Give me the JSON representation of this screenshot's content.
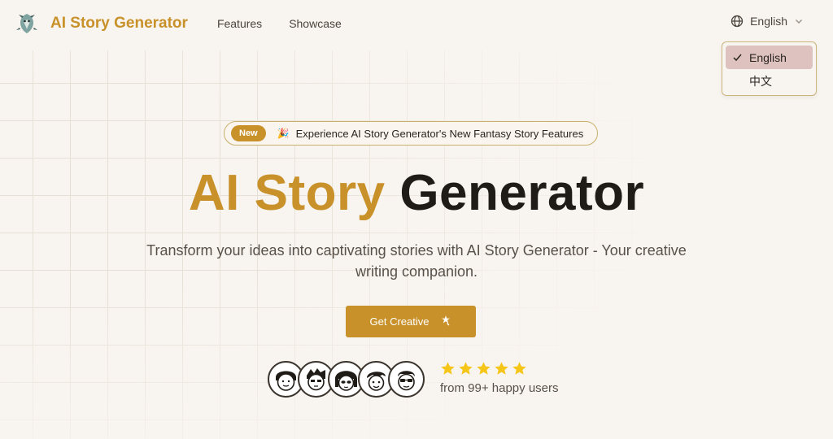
{
  "header": {
    "brand_title": "AI Story Generator",
    "logo_icon": "dragon-logo-icon",
    "nav": [
      {
        "label": "Features"
      },
      {
        "label": "Showcase"
      }
    ]
  },
  "language": {
    "current": "English",
    "options": [
      {
        "label": "English",
        "selected": true
      },
      {
        "label": "中文",
        "selected": false
      }
    ]
  },
  "announcement": {
    "badge": "New",
    "icon": "party-popper-icon",
    "text": "Experience AI Story Generator's New Fantasy Story Features"
  },
  "hero": {
    "title_accent": "AI Story",
    "title_dark": "Generator",
    "subtitle": "Transform your ideas into captivating stories with AI Story Generator - Your creative writing companion.",
    "cta_label": "Get Creative",
    "cta_icon": "magic-wand-icon"
  },
  "social_proof": {
    "avatar_count": 5,
    "rating_stars": 5,
    "text": "from 99+ happy users"
  },
  "colors": {
    "accent": "#c8912a",
    "background": "#f8f4ef",
    "dropdown_selected": "#ddc2c0",
    "star": "#f5c518"
  }
}
